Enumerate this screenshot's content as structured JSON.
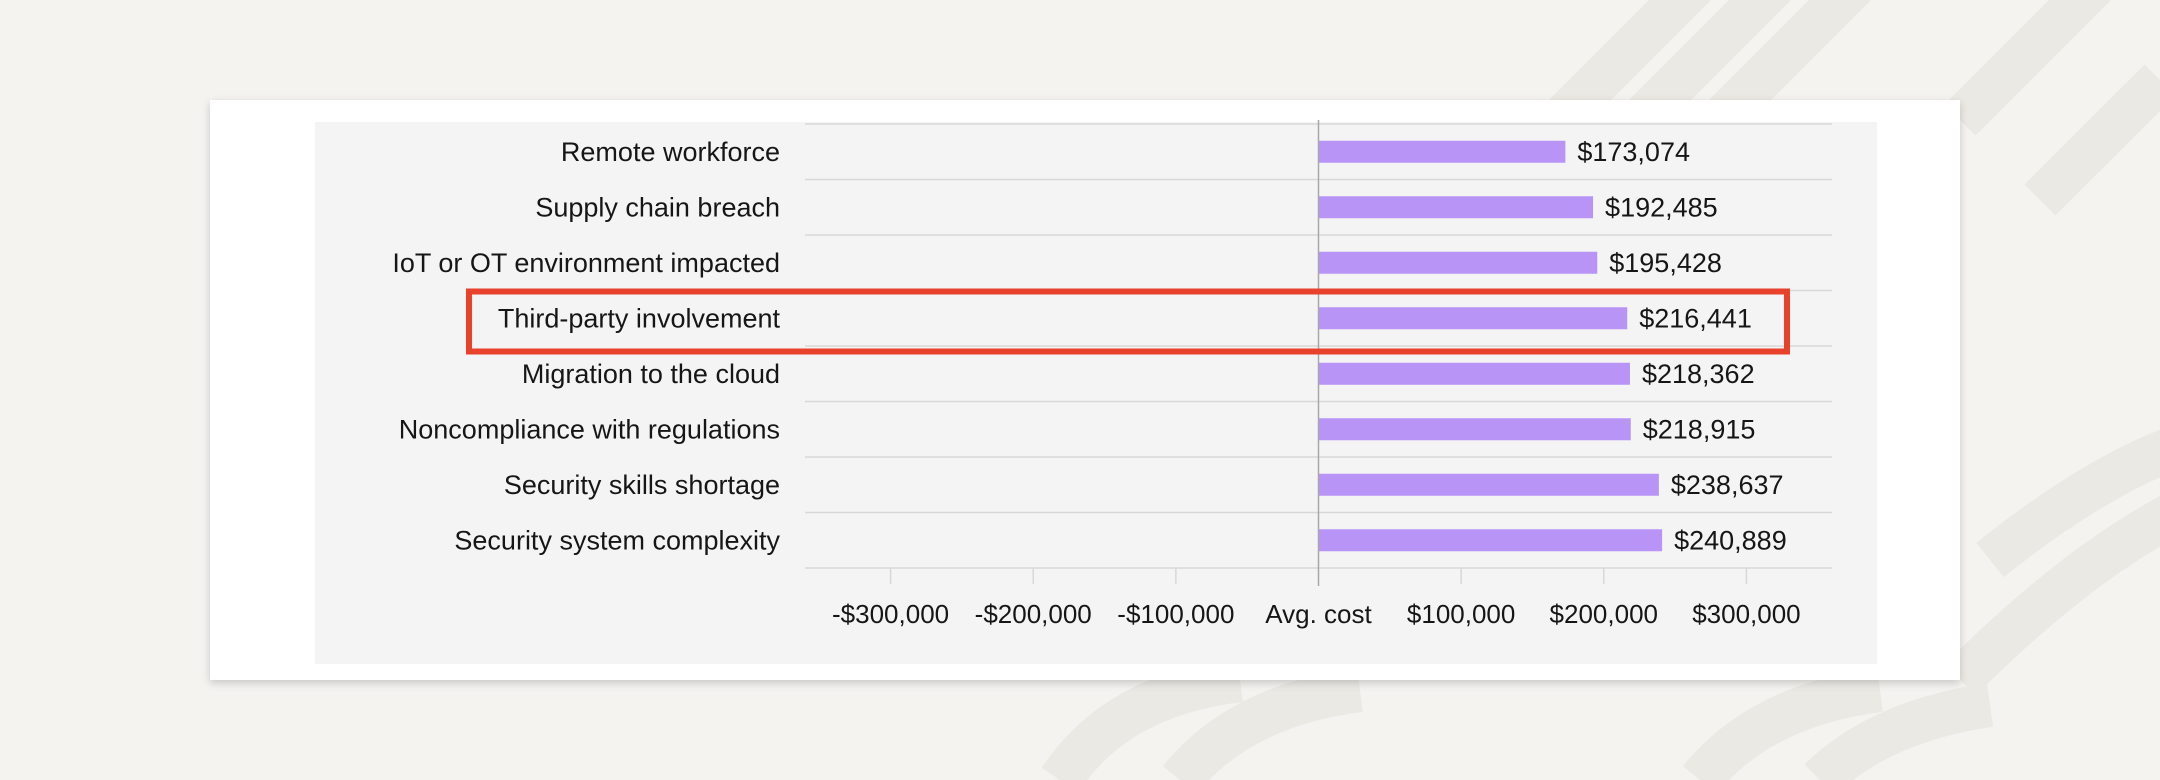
{
  "chart_data": {
    "type": "bar",
    "orientation": "horizontal",
    "title": "",
    "xlabel": "",
    "ylabel": "",
    "categories": [
      "Remote workforce",
      "Supply chain breach",
      "IoT or OT environment impacted",
      "Third-party involvement",
      "Migration to the cloud",
      "Noncompliance with regulations",
      "Security skills shortage",
      "Security system complexity"
    ],
    "values": [
      173074,
      192485,
      195428,
      216441,
      218362,
      218915,
      238637,
      240889
    ],
    "value_labels": [
      "$173,074",
      "$192,485",
      "$195,428",
      "$216,441",
      "$218,362",
      "$218,915",
      "$238,637",
      "$240,889"
    ],
    "xlim": [
      -360000,
      360000
    ],
    "x_ticks": [
      -300000,
      -200000,
      -100000,
      0,
      100000,
      200000,
      300000
    ],
    "x_tick_labels": [
      "-$300,000",
      "-$200,000",
      "-$100,000",
      "Avg. cost",
      "$100,000",
      "$200,000",
      "$300,000"
    ],
    "highlighted_category": "Third-party involvement",
    "grid": "horizontal",
    "legend": "none",
    "colors": {
      "bar": "#b794f6",
      "highlight": "#e8412c",
      "grid": "#d8d8d8",
      "zero_line": "#a8a8a8",
      "panel": "#f4f4f4"
    }
  }
}
